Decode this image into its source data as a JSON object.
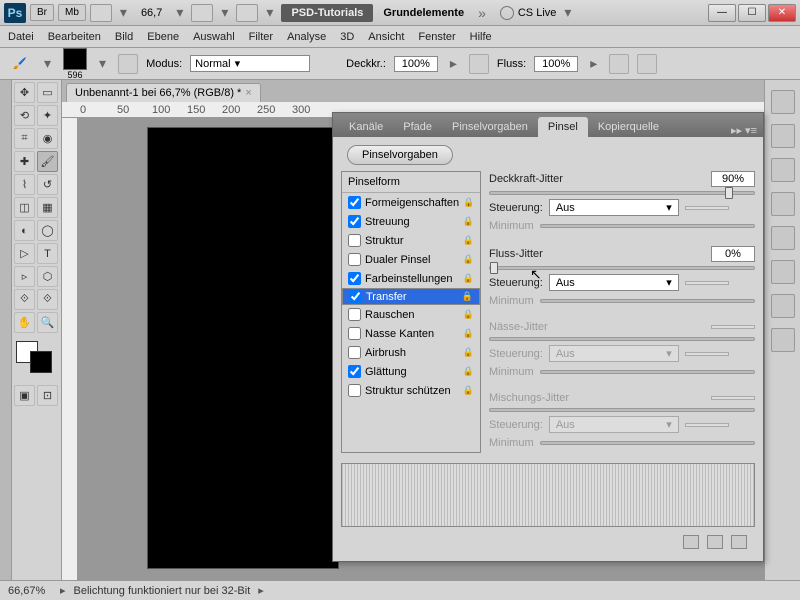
{
  "app": {
    "logo": "Ps"
  },
  "titlebar": {
    "buttons": [
      "Br",
      "Mb"
    ],
    "zoom": "66,7",
    "bar_dark": "PSD-Tutorials",
    "bar_text": "Grundelemente",
    "cslive": "CS Live"
  },
  "menu": [
    "Datei",
    "Bearbeiten",
    "Bild",
    "Ebene",
    "Auswahl",
    "Filter",
    "Analyse",
    "3D",
    "Ansicht",
    "Fenster",
    "Hilfe"
  ],
  "options": {
    "size": "596",
    "mode_label": "Modus:",
    "mode_value": "Normal",
    "opacity_label": "Deckkr.:",
    "opacity_value": "100%",
    "flow_label": "Fluss:",
    "flow_value": "100%"
  },
  "document": {
    "tab": "Unbenannt-1 bei 66,7% (RGB/8) *",
    "ruler_marks": [
      "0",
      "50",
      "100",
      "150",
      "200",
      "250",
      "300"
    ]
  },
  "panel": {
    "tabs": [
      "Kanäle",
      "Pfade",
      "Pinselvorgaben",
      "Pinsel",
      "Kopierquelle"
    ],
    "active_tab": 3,
    "presets_btn": "Pinselvorgaben",
    "list_header": "Pinselform",
    "items": [
      {
        "label": "Formeigenschaften",
        "checked": true
      },
      {
        "label": "Streuung",
        "checked": true
      },
      {
        "label": "Struktur",
        "checked": false
      },
      {
        "label": "Dualer Pinsel",
        "checked": false
      },
      {
        "label": "Farbeinstellungen",
        "checked": true
      },
      {
        "label": "Transfer",
        "checked": true,
        "selected": true
      },
      {
        "label": "Rauschen",
        "checked": false
      },
      {
        "label": "Nasse Kanten",
        "checked": false
      },
      {
        "label": "Airbrush",
        "checked": false
      },
      {
        "label": "Glättung",
        "checked": true
      },
      {
        "label": "Struktur schützen",
        "checked": false
      }
    ],
    "right": {
      "opacity_jitter": "Deckkraft-Jitter",
      "opacity_val": "90%",
      "control_label": "Steuerung:",
      "control_val": "Aus",
      "minimum": "Minimum",
      "flow_jitter": "Fluss-Jitter",
      "flow_val": "0%",
      "wet_jitter": "Nässe-Jitter",
      "mix_jitter": "Mischungs-Jitter"
    }
  },
  "status": {
    "pct": "66,67%",
    "msg": "Belichtung funktioniert nur bei 32-Bit"
  }
}
